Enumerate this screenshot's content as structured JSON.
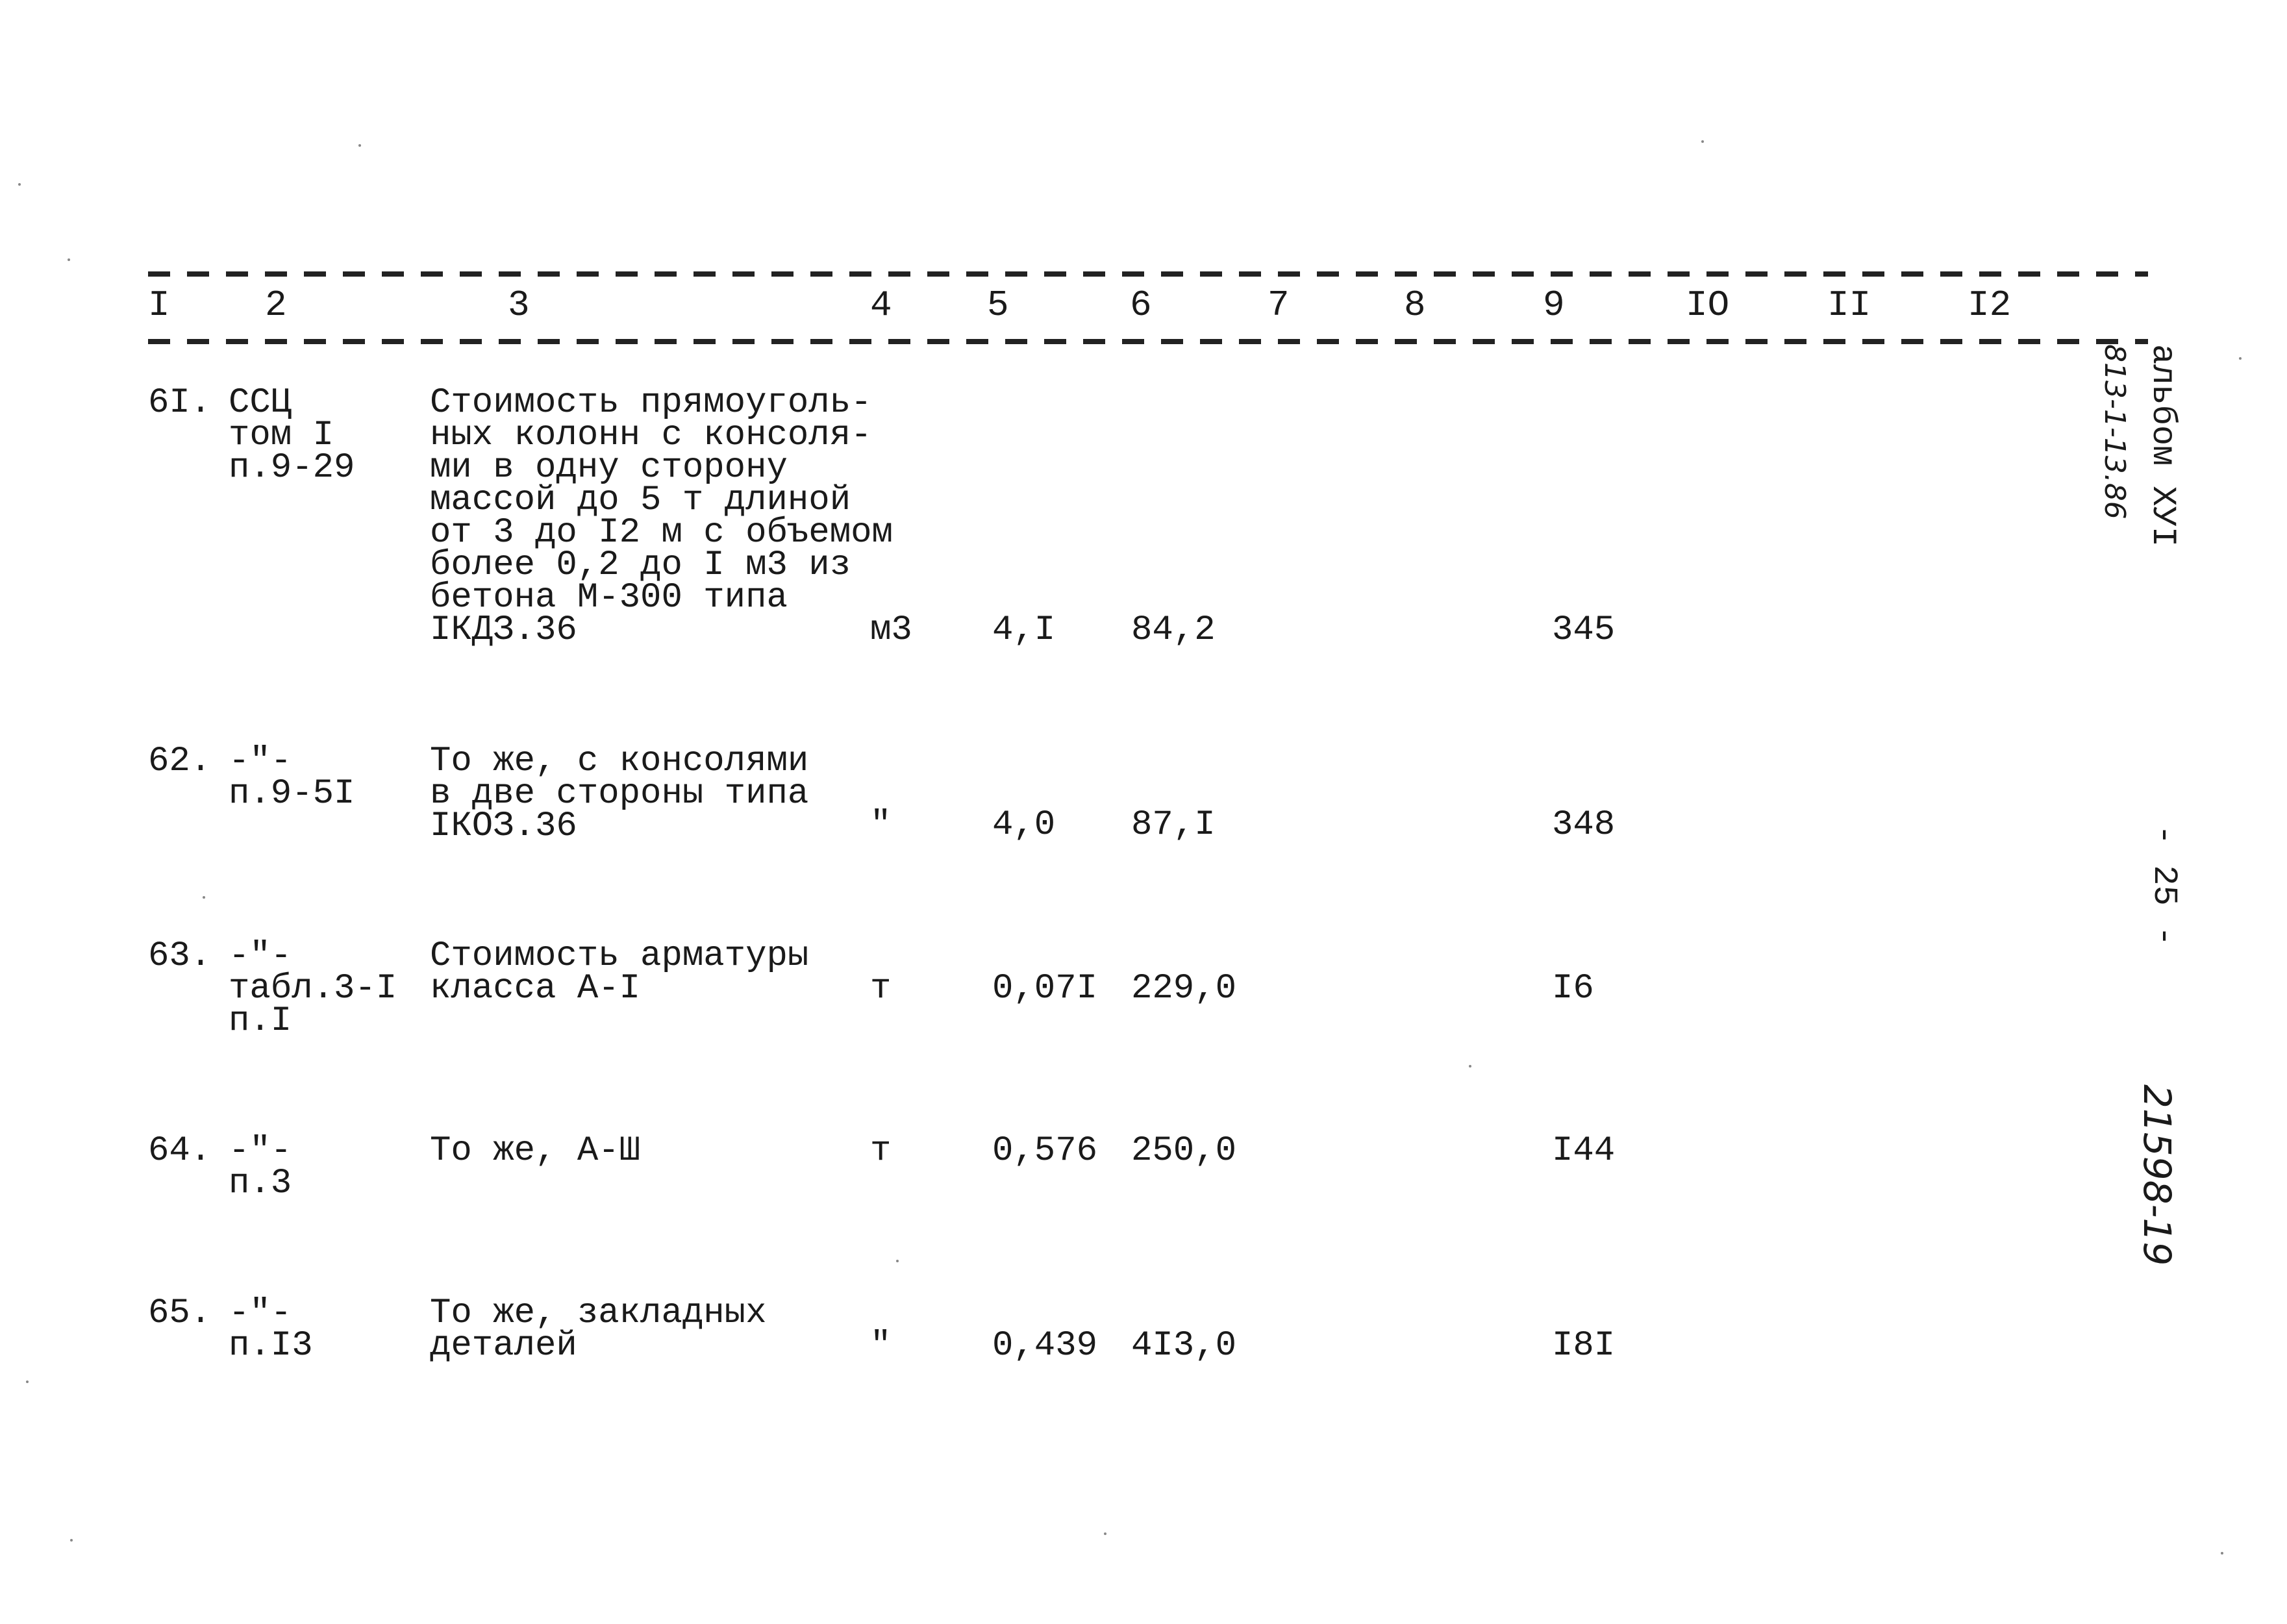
{
  "header": {
    "columns": [
      "I",
      "2",
      "3",
      "4",
      "5",
      "6",
      "7",
      "8",
      "9",
      "IO",
      "II",
      "I2"
    ]
  },
  "rows": [
    {
      "num": "6I.",
      "ref": "ССЦ\nтом I\nп.9-29",
      "desc": "Стоимость прямоуголь-\nных колонн с консоля-\nми в одну сторону\nмассой до 5 т длиной\nот 3 до I2 м с объемом\nболее 0,2 до I м3 из\nбетона М-300 типа\nIКДЗ.36",
      "unit": "м3",
      "qty": "4,I",
      "price": "84,2",
      "total": "345"
    },
    {
      "num": "62.",
      "ref": "-\"-\nп.9-5I",
      "desc": "То же, с консолями\nв две стороны типа\nIКОЗ.36",
      "unit": "\"",
      "qty": "4,0",
      "price": "87,I",
      "total": "348"
    },
    {
      "num": "63.",
      "ref": "-\"-\nтабл.3-I\nп.I",
      "desc": "Стоимость арматуры\nкласса А-I",
      "unit": "т",
      "qty": "0,07I",
      "price": "229,0",
      "total": "I6"
    },
    {
      "num": "64.",
      "ref": "-\"-\nп.3",
      "desc": "То же, А-Ш",
      "unit": "т",
      "qty": "0,576",
      "price": "250,0",
      "total": "I44"
    },
    {
      "num": "65.",
      "ref": "-\"-\nп.I3",
      "desc": "То же, закладных\nдеталей",
      "unit": "\"",
      "qty": "0,439",
      "price": "4I3,0",
      "total": "I8I"
    }
  ],
  "margin": {
    "album_label": "альбом ХУI",
    "album_code": "813-1-13.86",
    "page_number": "- 25 -",
    "document_code": "21598-19"
  }
}
